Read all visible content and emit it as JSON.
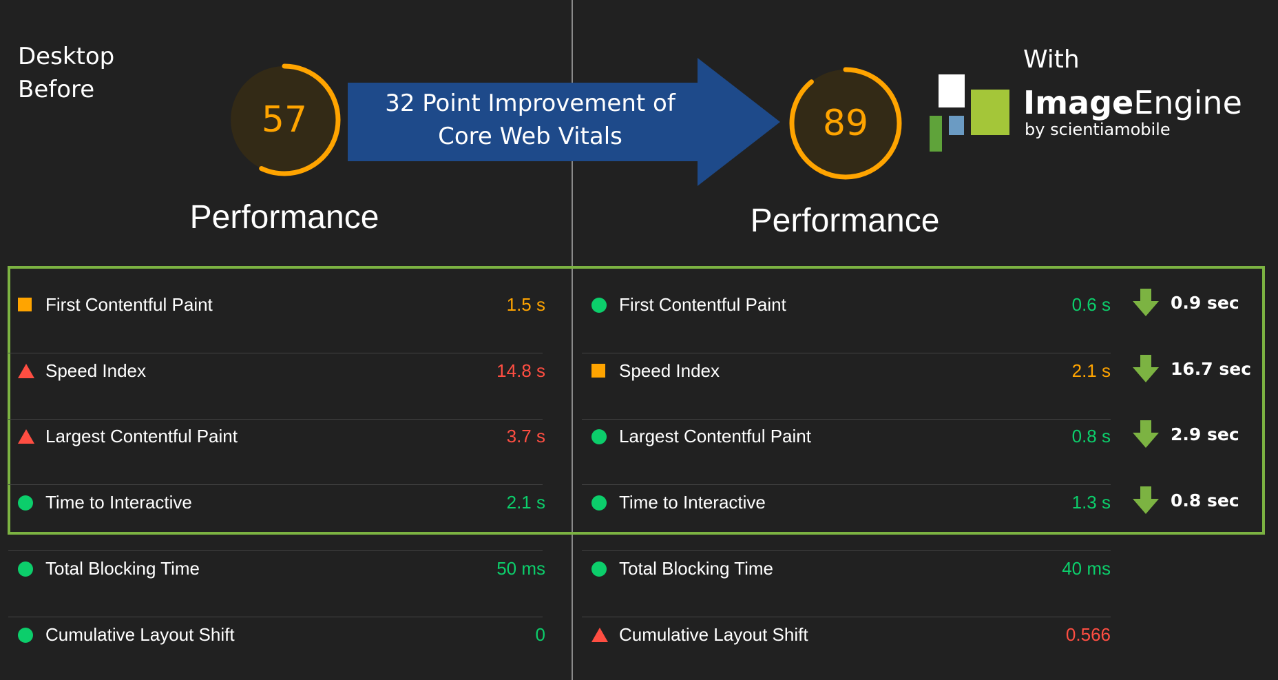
{
  "left": {
    "label_line1": "Desktop",
    "label_line2": "Before",
    "score": "57",
    "score_fraction": 0.57,
    "category": "Performance"
  },
  "right": {
    "with_label": "With",
    "score": "89",
    "score_fraction": 0.89,
    "category": "Performance"
  },
  "banner": {
    "line1": "32 Point Improvement of",
    "line2": "Core Web Vitals"
  },
  "logo": {
    "bold": "Image",
    "regular": "Engine",
    "sub": "by scientiamobile"
  },
  "colors": {
    "pass": "#0cce6b",
    "average": "#ffa400",
    "fail": "#ff4e42",
    "frame": "#7cb342",
    "banner": "#1e4a8a"
  },
  "metrics_before": [
    {
      "name": "First Contentful Paint",
      "value": "1.5 s",
      "status": "average"
    },
    {
      "name": "Speed Index",
      "value": "14.8 s",
      "status": "fail"
    },
    {
      "name": "Largest Contentful Paint",
      "value": "3.7 s",
      "status": "fail"
    },
    {
      "name": "Time to Interactive",
      "value": "2.1 s",
      "status": "pass"
    },
    {
      "name": "Total Blocking Time",
      "value": "50 ms",
      "status": "pass"
    },
    {
      "name": "Cumulative Layout Shift",
      "value": "0",
      "status": "pass"
    }
  ],
  "metrics_after": [
    {
      "name": "First Contentful Paint",
      "value": "0.6 s",
      "status": "pass",
      "delta": "0.9 sec"
    },
    {
      "name": "Speed Index",
      "value": "2.1 s",
      "status": "average",
      "delta": "16.7 sec"
    },
    {
      "name": "Largest Contentful Paint",
      "value": "0.8 s",
      "status": "pass",
      "delta": "2.9 sec"
    },
    {
      "name": "Time to Interactive",
      "value": "1.3 s",
      "status": "pass",
      "delta": "0.8 sec"
    },
    {
      "name": "Total Blocking Time",
      "value": "40 ms",
      "status": "pass"
    },
    {
      "name": "Cumulative Layout Shift",
      "value": "0.566",
      "status": "fail"
    }
  ]
}
